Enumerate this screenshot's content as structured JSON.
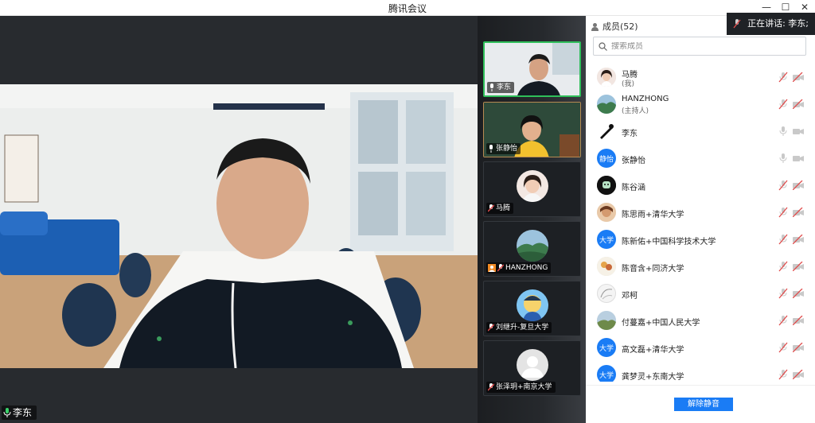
{
  "window": {
    "title": "腾讯会议",
    "minimize": "—",
    "maximize": "☐",
    "close": "✕"
  },
  "main_video": {
    "speaker": "李东"
  },
  "thumbnails": [
    {
      "name": "李东"
    },
    {
      "name": "张静怡"
    },
    {
      "name": "马腾"
    },
    {
      "name": "HANZHONG"
    },
    {
      "name": "刘继升-复旦大学"
    },
    {
      "name": "张泽玥+南京大学"
    }
  ],
  "panel": {
    "members_title": "成员(52)",
    "speaking_toast": "正在讲话: 李东;",
    "search_placeholder": "搜索成员",
    "unmute_all": "解除静音"
  },
  "members": [
    {
      "name": "马腾",
      "role": "(我)",
      "avatar": "photo-woman"
    },
    {
      "name": "HANZHONG",
      "role": "(主持人)",
      "avatar": "landscape"
    },
    {
      "name": "李东",
      "role": "",
      "avatar": "sketch"
    },
    {
      "name": "张静怡",
      "role": "",
      "avatar_text": "静怡",
      "avatar": "blue"
    },
    {
      "name": "陈谷涵",
      "role": "",
      "avatar": "cartoon"
    },
    {
      "name": "陈思雨+清华大学",
      "role": "",
      "avatar": "photo"
    },
    {
      "name": "陈新佑+中国科学技术大学",
      "role": "",
      "avatar_text": "大学",
      "avatar": "blue"
    },
    {
      "name": "陈音含+同济大学",
      "role": "",
      "avatar": "flower"
    },
    {
      "name": "邓柯",
      "role": "",
      "avatar": "sketch-light"
    },
    {
      "name": "付蔓嘉+中国人民大学",
      "role": "",
      "avatar": "landscape"
    },
    {
      "name": "高文磊+清华大学",
      "role": "",
      "avatar_text": "大学",
      "avatar": "blue"
    },
    {
      "name": "龚梦灵+东南大学",
      "role": "",
      "avatar_text": "大学",
      "avatar": "blue"
    }
  ],
  "colors": {
    "accent": "#1a7cf5",
    "active_border": "#2fbf5a",
    "muted_red": "#e04b4b"
  }
}
